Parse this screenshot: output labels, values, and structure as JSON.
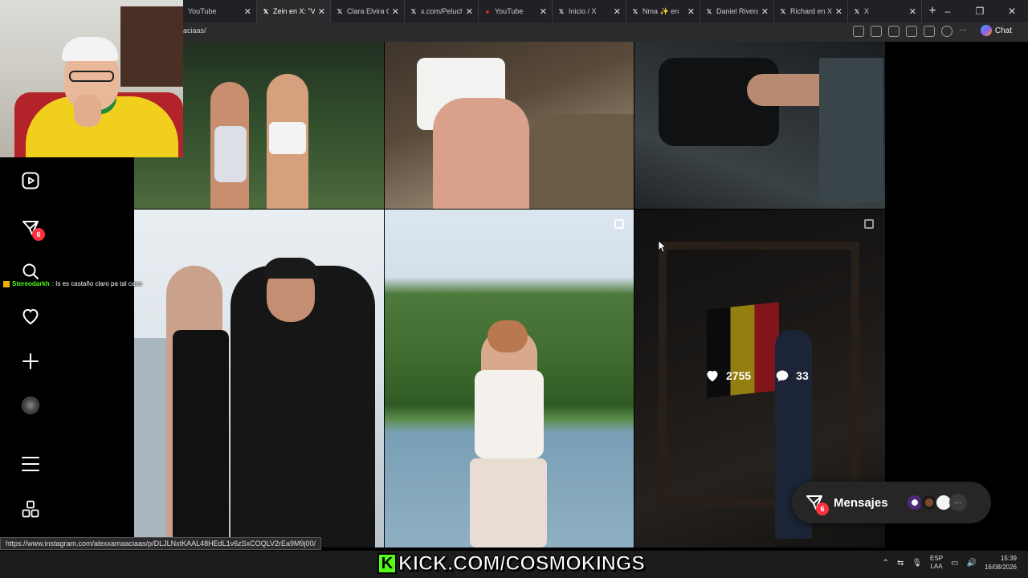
{
  "browser": {
    "tabs": [
      {
        "label": "YouTube",
        "icon": "youtube-icon",
        "active": false
      },
      {
        "label": "Zein en X: \"Van",
        "icon": "x-icon",
        "active": true
      },
      {
        "label": "Clara Elvira Ou",
        "icon": "x-icon",
        "active": false
      },
      {
        "label": "x.com/Peluche",
        "icon": "x-icon",
        "active": false
      },
      {
        "label": "YouTube",
        "icon": "youtube-icon",
        "active": false
      },
      {
        "label": "Inicio / X",
        "icon": "x-icon",
        "active": false
      },
      {
        "label": "Nma ✨ en",
        "icon": "x-icon",
        "active": false
      },
      {
        "label": "Daniel Rivera",
        "icon": "x-icon",
        "active": false
      },
      {
        "label": "Richard en X:",
        "icon": "x-icon",
        "active": false
      },
      {
        "label": "X",
        "icon": "x-icon",
        "active": false
      }
    ],
    "url_fragment": "aciaas/",
    "chat_label": "Chat",
    "new_tab": "+",
    "window_controls": {
      "minimize": "–",
      "maximize": "❐",
      "close": "✕"
    }
  },
  "post_hover": {
    "likes": "2755",
    "comments": "33"
  },
  "sidebar": {
    "notifications_badge": "6"
  },
  "stream_chat": {
    "username": "Stereodarkh",
    "message": ": Is es castaño claro pa tal caso"
  },
  "messages": {
    "label": "Mensajes",
    "badge": "6",
    "more": "···"
  },
  "status_url": "https://www.instagram.com/alexxamaaciaas/p/DLJLNxtKAAL48HEdL1v6zSxCOQLV2rEa9M9j00/",
  "overlay_brand": {
    "k": "K",
    "text": "KICK.COM/COSMOKINGS"
  },
  "taskbar": {
    "lang_top": "ESP",
    "lang_bottom": "LAA",
    "time": "15:39",
    "date": "16/08/2026"
  },
  "colors": {
    "badge": "#ff3040",
    "kick_green": "#53fc18",
    "pill_bg": "#262626"
  }
}
